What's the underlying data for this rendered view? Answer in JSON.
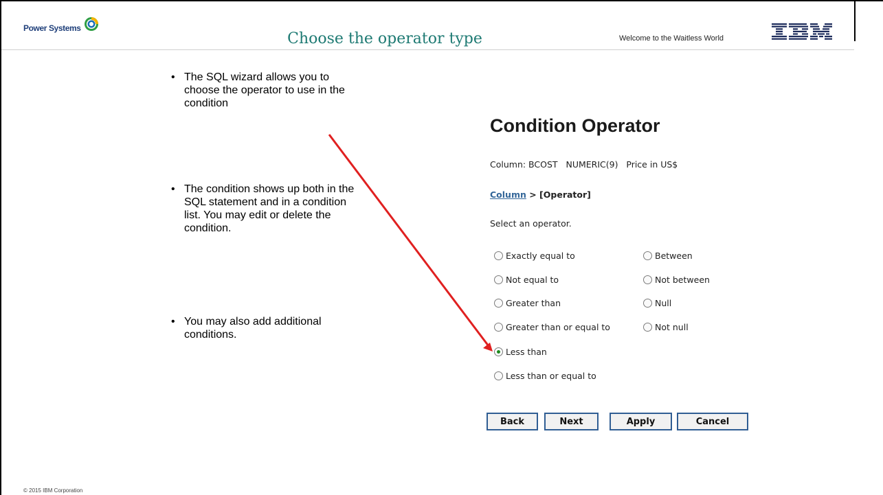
{
  "header": {
    "brand": "Power Systems",
    "title": "Choose the operator type",
    "tagline": "Welcome to the Waitless World",
    "logo": "IBM"
  },
  "bullets": [
    "The SQL wizard allows you to choose the operator to use in the condition",
    "The condition shows up both in the SQL statement and in a condition list.  You may edit or delete the condition.",
    "You may also add additional conditions."
  ],
  "wizard": {
    "title": "Condition Operator",
    "column_info": "Column: BCOST   NUMERIC(9)   Price in US$",
    "breadcrumb_link": "Column",
    "breadcrumb_current": " > [Operator]",
    "instruction": "Select an operator.",
    "operators": [
      {
        "label": "Exactly equal to",
        "checked": false
      },
      {
        "label": "Between",
        "checked": false
      },
      {
        "label": "Not equal to",
        "checked": false
      },
      {
        "label": "Not between",
        "checked": false
      },
      {
        "label": "Greater than",
        "checked": false
      },
      {
        "label": "Null",
        "checked": false
      },
      {
        "label": "Greater than or equal to",
        "checked": false
      },
      {
        "label": "Not null",
        "checked": false
      },
      {
        "label": "Less than",
        "checked": true
      },
      {
        "label": "Less than or equal to",
        "checked": false
      }
    ],
    "buttons": {
      "back": "Back",
      "next": "Next",
      "apply": "Apply",
      "cancel": "Cancel"
    }
  },
  "footer": "© 2015 IBM Corporation",
  "colors": {
    "title": "#1e7a73",
    "arrow": "#e02020",
    "button_border": "#2f5d93",
    "link": "#336699",
    "radio_selected": "#1d8a1d"
  }
}
